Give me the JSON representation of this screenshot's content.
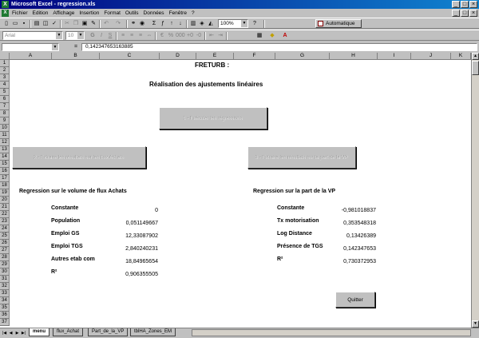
{
  "window": {
    "title": "Microsoft Excel - regression.xls",
    "app_icon": "X",
    "buttons": [
      "_",
      "□",
      "×"
    ]
  },
  "menubar": {
    "items": [
      "Fichier",
      "Edition",
      "Affichage",
      "Insertion",
      "Format",
      "Outils",
      "Données",
      "Fenêtre",
      "?"
    ]
  },
  "toolbar": {
    "zoom": "100%",
    "automatique_label": "Automatique"
  },
  "formatting": {
    "font": "Arial",
    "size": "10"
  },
  "formula_bar": {
    "name_box": "",
    "eq": "=",
    "content": "0,142347653163885"
  },
  "columns": [
    "A",
    "B",
    "C",
    "D",
    "E",
    "F",
    "G",
    "H",
    "I",
    "J",
    "K"
  ],
  "rows": [
    "1",
    "2",
    "3",
    "4",
    "5",
    "6",
    "7",
    "8",
    "9",
    "10",
    "11",
    "12",
    "13",
    "14",
    "15",
    "16",
    "17",
    "18",
    "19",
    "20",
    "21",
    "22",
    "23",
    "24",
    "25",
    "26",
    "27",
    "28",
    "29",
    "30",
    "31",
    "32",
    "33",
    "34",
    "35",
    "36",
    "37"
  ],
  "sheet": {
    "title": "FRETURB :",
    "subtitle": "Réalisation des ajustements linéaires",
    "buttons": {
      "run": "1 - Exécuter les régressions",
      "achats": "2 - Extraire les résultats sur les flux Achats",
      "vp": "3 - Extraire les résultats sur la part de la VP",
      "quit": "Quitter"
    },
    "left": {
      "heading": "Regression sur le volume de flux Achats",
      "rows": [
        {
          "label": "Constante",
          "value": "0"
        },
        {
          "label": "Population",
          "value": "0,051149667"
        },
        {
          "label": "Emploi GS",
          "value": "12,33087902"
        },
        {
          "label": "Emploi TGS",
          "value": "2,840240231"
        },
        {
          "label": "Autres etab com",
          "value": "18,84965654"
        },
        {
          "label": "R²",
          "value": "0,906355505"
        }
      ]
    },
    "right": {
      "heading": "Regression sur la part de la VP",
      "rows": [
        {
          "label": "Constante",
          "value": "-0,981018837"
        },
        {
          "label": "Tx motorisation",
          "value": "0,353548318"
        },
        {
          "label": "Log Distance",
          "value": "0,13426389"
        },
        {
          "label": "Présence de TGS",
          "value": "0,142347653"
        },
        {
          "label": "R²",
          "value": "0,730372953"
        }
      ]
    }
  },
  "tabs": [
    "menu",
    "flux_Achat",
    "Part_de_la_VP",
    "tblHA_Zones_EM"
  ]
}
